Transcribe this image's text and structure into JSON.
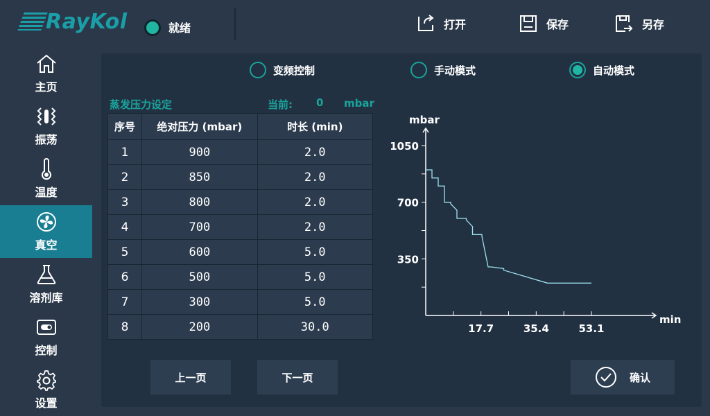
{
  "brand": {
    "logo_text": "RayKol"
  },
  "status": {
    "text": "就绪",
    "color": "#1fb5a2"
  },
  "toolbar": {
    "open_label": "打开",
    "save_label": "保存",
    "saveas_label": "另存"
  },
  "sidebar": {
    "items": [
      {
        "label": "主页",
        "icon": "home-icon"
      },
      {
        "label": "振荡",
        "icon": "shake-icon"
      },
      {
        "label": "温度",
        "icon": "thermometer-icon"
      },
      {
        "label": "真空",
        "icon": "vacuum-fan-icon"
      },
      {
        "label": "溶剂库",
        "icon": "flask-icon"
      },
      {
        "label": "控制",
        "icon": "control-icon"
      },
      {
        "label": "设置",
        "icon": "gear-icon"
      }
    ],
    "active_index": 3
  },
  "modes": [
    {
      "label": "变频控制",
      "selected": false
    },
    {
      "label": "手动模式",
      "selected": false
    },
    {
      "label": "自动模式",
      "selected": true
    }
  ],
  "pressure": {
    "setting_label": "蒸发压力设定",
    "current_label": "当前:",
    "current_value": "0",
    "current_unit": "mbar"
  },
  "table": {
    "headers": [
      "序号",
      "绝对压力 (mbar)",
      "时长 (min)"
    ],
    "rows": [
      [
        "1",
        "900",
        "2.0"
      ],
      [
        "2",
        "850",
        "2.0"
      ],
      [
        "3",
        "800",
        "2.0"
      ],
      [
        "4",
        "700",
        "2.0"
      ],
      [
        "5",
        "600",
        "5.0"
      ],
      [
        "6",
        "500",
        "5.0"
      ],
      [
        "7",
        "300",
        "5.0"
      ],
      [
        "8",
        "200",
        "30.0"
      ]
    ]
  },
  "chart_data": {
    "type": "line",
    "xlabel": "min",
    "ylabel": "mbar",
    "x_ticks": [
      "17.7",
      "35.4",
      "53.1"
    ],
    "y_ticks": [
      "350",
      "700",
      "1050"
    ],
    "xlim": [
      0,
      53.1
    ],
    "ylim": [
      0,
      1050
    ],
    "line_color": "#9fe3f0",
    "series": [
      {
        "x": [
          0,
          2,
          2,
          4,
          4,
          6,
          6,
          8,
          8,
          10,
          10,
          13,
          13,
          15,
          15,
          18,
          18,
          20,
          20,
          21,
          21,
          25,
          25,
          39,
          39,
          53.1
        ],
        "y": [
          900,
          900,
          850,
          850,
          800,
          800,
          700,
          700,
          690,
          650,
          600,
          600,
          590,
          550,
          500,
          500,
          490,
          300,
          300,
          300,
          300,
          290,
          280,
          200,
          200,
          200
        ]
      }
    ]
  },
  "buttons": {
    "prev_label": "上一页",
    "next_label": "下一页",
    "confirm_label": "确认"
  }
}
